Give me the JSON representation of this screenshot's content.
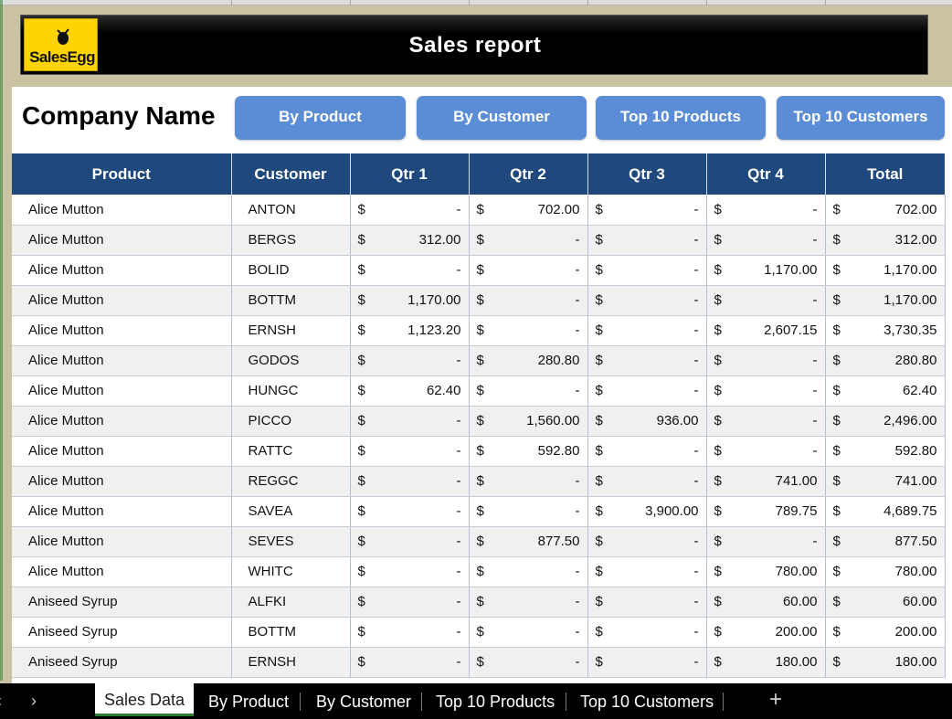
{
  "banner": {
    "logo_text": "SalesEgg",
    "title": "Sales report"
  },
  "company_name": "Company Name",
  "nav_buttons": [
    "By Product",
    "By Customer",
    "Top 10 Products",
    "Top 10 Customers"
  ],
  "table": {
    "columns": [
      "Product",
      "Customer",
      "Qtr 1",
      "Qtr 2",
      "Qtr 3",
      "Qtr 4",
      "Total"
    ],
    "currency_symbol": "$",
    "rows": [
      [
        "Alice Mutton",
        "ANTON",
        "-",
        "702.00",
        "-",
        "-",
        "702.00"
      ],
      [
        "Alice Mutton",
        "BERGS",
        "312.00",
        "-",
        "-",
        "-",
        "312.00"
      ],
      [
        "Alice Mutton",
        "BOLID",
        "-",
        "-",
        "-",
        "1,170.00",
        "1,170.00"
      ],
      [
        "Alice Mutton",
        "BOTTM",
        "1,170.00",
        "-",
        "-",
        "-",
        "1,170.00"
      ],
      [
        "Alice Mutton",
        "ERNSH",
        "1,123.20",
        "-",
        "-",
        "2,607.15",
        "3,730.35"
      ],
      [
        "Alice Mutton",
        "GODOS",
        "-",
        "280.80",
        "-",
        "-",
        "280.80"
      ],
      [
        "Alice Mutton",
        "HUNGC",
        "62.40",
        "-",
        "-",
        "-",
        "62.40"
      ],
      [
        "Alice Mutton",
        "PICCO",
        "-",
        "1,560.00",
        "936.00",
        "-",
        "2,496.00"
      ],
      [
        "Alice Mutton",
        "RATTC",
        "-",
        "592.80",
        "-",
        "-",
        "592.80"
      ],
      [
        "Alice Mutton",
        "REGGC",
        "-",
        "-",
        "-",
        "741.00",
        "741.00"
      ],
      [
        "Alice Mutton",
        "SAVEA",
        "-",
        "-",
        "3,900.00",
        "789.75",
        "4,689.75"
      ],
      [
        "Alice Mutton",
        "SEVES",
        "-",
        "877.50",
        "-",
        "-",
        "877.50"
      ],
      [
        "Alice Mutton",
        "WHITC",
        "-",
        "-",
        "-",
        "780.00",
        "780.00"
      ],
      [
        "Aniseed Syrup",
        "ALFKI",
        "-",
        "-",
        "-",
        "60.00",
        "60.00"
      ],
      [
        "Aniseed Syrup",
        "BOTTM",
        "-",
        "-",
        "-",
        "200.00",
        "200.00"
      ],
      [
        "Aniseed Syrup",
        "ERNSH",
        "-",
        "-",
        "-",
        "180.00",
        "180.00"
      ]
    ]
  },
  "sheet_tabs": {
    "items": [
      "Sales Data",
      "By Product",
      "By Customer",
      "Top 10 Products",
      "Top 10 Customers"
    ],
    "active": "Sales Data",
    "prev_icon": "‹",
    "next_icon": "›",
    "add_icon": "+"
  },
  "colors": {
    "header_bg": "#1f497d",
    "button_bg": "#5b8dd6",
    "logo_bg": "#ffd400",
    "frame_bg": "#c9c3a4"
  }
}
